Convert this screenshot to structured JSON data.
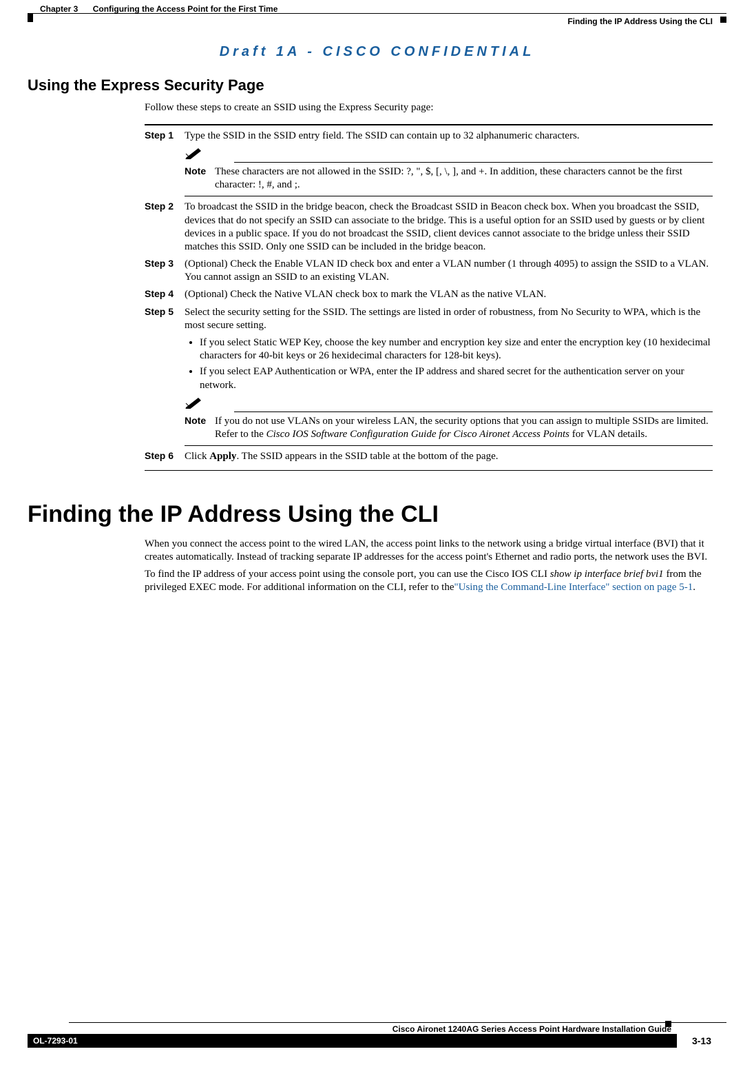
{
  "header": {
    "chapter_num": "Chapter 3",
    "chapter_title": "Configuring the Access Point for the First Time",
    "section_title": "Finding the IP Address Using the CLI"
  },
  "watermark": "Draft 1A - CISCO CONFIDENTIAL",
  "h2": "Using the Express Security Page",
  "intro": "Follow these steps to create an SSID using the Express Security page:",
  "steps": [
    {
      "label": "Step 1",
      "text": "Type the SSID in the SSID entry field. The SSID can contain up to 32 alphanumeric characters."
    },
    {
      "label": "Step 2",
      "text": "To broadcast the SSID in the bridge beacon, check the Broadcast SSID in Beacon check box. When you broadcast the SSID, devices that do not specify an SSID can associate to the bridge. This is a useful option for an SSID used by guests or by client devices in a public space. If you do not broadcast the SSID, client devices cannot associate to the bridge unless their SSID matches this SSID. Only one SSID can be included in the bridge beacon."
    },
    {
      "label": "Step 3",
      "text": "(Optional) Check the Enable VLAN ID check box and enter a VLAN number (1 through 4095) to assign the SSID to a VLAN. You cannot assign an SSID to an existing VLAN."
    },
    {
      "label": "Step 4",
      "text": "(Optional) Check the Native VLAN check box to mark the VLAN as the native VLAN."
    },
    {
      "label": "Step 5",
      "text": "Select the security setting for the SSID. The settings are listed in order of robustness, from No Security to WPA, which is the most secure setting."
    },
    {
      "label": "Step 6",
      "text_pre": "Click ",
      "text_bold": "Apply",
      "text_post": ". The SSID appears in the SSID table at the bottom of the page."
    }
  ],
  "note1": {
    "label": "Note",
    "text": "These characters are not allowed in the SSID: ?, \", $, [, \\, ], and +. In addition, these characters cannot be the first character: !, #, and ;."
  },
  "bullets": [
    "If you select Static WEP Key, choose the key number and encryption key size and enter the encryption key (10 hexidecimal characters for 40-bit keys or 26 hexidecimal characters for 128-bit keys).",
    "If you select EAP Authentication or WPA, enter the IP address and shared secret for the authentication server on your network."
  ],
  "note2": {
    "label": "Note",
    "pre": "If you do not use VLANs on your wireless LAN, the security options that you can assign to multiple SSIDs are limited. Refer to the ",
    "italic": "Cisco IOS Software Configuration Guide for Cisco Aironet Access Points",
    "post": " for VLAN details."
  },
  "h1": "Finding the IP Address Using the CLI",
  "para1": "When you connect the access point to the wired LAN, the access point links to the network using a bridge virtual interface (BVI) that it creates automatically. Instead of tracking separate IP addresses for the access point's Ethernet and radio ports, the network uses the BVI.",
  "para2": {
    "pre": "To find the IP address of your access point using the console port, you can use the Cisco IOS CLI ",
    "italic": "show ip interface brief bvi1",
    "mid": " from the privileged EXEC mode. For additional information on the CLI, refer to the",
    "link": "\"Using the Command-Line Interface\" section on page 5-1",
    "post": "."
  },
  "footer": {
    "book_title": "Cisco Aironet 1240AG Series Access Point Hardware Installation Guide",
    "doc_num": "OL-7293-01",
    "page_num": "3-13"
  }
}
